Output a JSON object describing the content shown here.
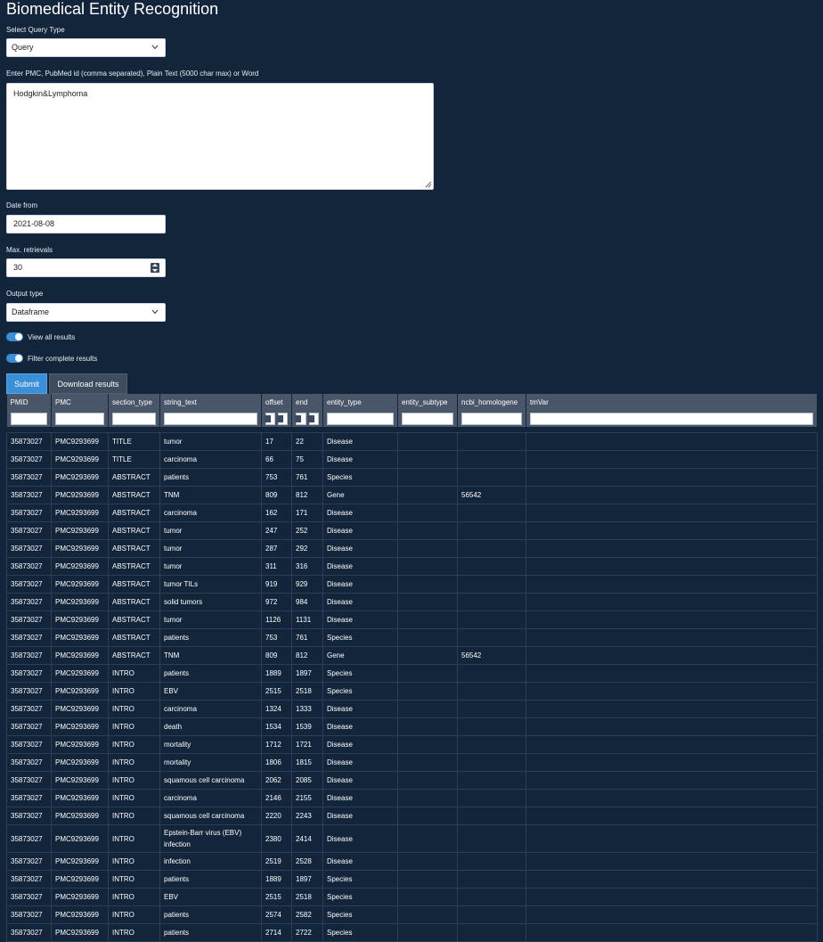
{
  "app": {
    "title": "Biomedical Entity Recognition"
  },
  "query_type": {
    "label": "Select Query Type",
    "value": "Query"
  },
  "query_input": {
    "label": "Enter PMC, PubMed id (comma separated), Plain Text (5000 char max) or Word",
    "value": "Hodgkin&Lymphoma"
  },
  "date_from": {
    "label": "Date from",
    "value": "2021-08-08"
  },
  "max_retrievals": {
    "label": "Max. retrievals",
    "value": "30"
  },
  "output_type": {
    "label": "Output type",
    "value": "Dataframe"
  },
  "toggles": {
    "view_all": {
      "label": "View all results",
      "on": true
    },
    "filter_complete": {
      "label": "Filter complete results",
      "on": true
    }
  },
  "buttons": {
    "submit": "Submit",
    "download": "Download results"
  },
  "colors": {
    "background": "#13253a",
    "accent": "#3b8ed8",
    "header": "#495669"
  },
  "table": {
    "columns": [
      "PMID",
      "PMC",
      "section_type",
      "string_text",
      "offset",
      "end",
      "entity_type",
      "entity_subtype",
      "ncbi_homologene",
      "tmVar"
    ],
    "rows": [
      [
        "35873027",
        "PMC9293699",
        "TITLE",
        "tumor",
        "17",
        "22",
        "Disease",
        "",
        "",
        ""
      ],
      [
        "35873027",
        "PMC9293699",
        "TITLE",
        "carcinoma",
        "66",
        "75",
        "Disease",
        "",
        "",
        ""
      ],
      [
        "35873027",
        "PMC9293699",
        "ABSTRACT",
        "patients",
        "753",
        "761",
        "Species",
        "",
        "",
        ""
      ],
      [
        "35873027",
        "PMC9293699",
        "ABSTRACT",
        "TNM",
        "809",
        "812",
        "Gene",
        "",
        "56542",
        ""
      ],
      [
        "35873027",
        "PMC9293699",
        "ABSTRACT",
        "carcinoma",
        "162",
        "171",
        "Disease",
        "",
        "",
        ""
      ],
      [
        "35873027",
        "PMC9293699",
        "ABSTRACT",
        "tumor",
        "247",
        "252",
        "Disease",
        "",
        "",
        ""
      ],
      [
        "35873027",
        "PMC9293699",
        "ABSTRACT",
        "tumor",
        "287",
        "292",
        "Disease",
        "",
        "",
        ""
      ],
      [
        "35873027",
        "PMC9293699",
        "ABSTRACT",
        "tumor",
        "311",
        "316",
        "Disease",
        "",
        "",
        ""
      ],
      [
        "35873027",
        "PMC9293699",
        "ABSTRACT",
        "tumor TILs",
        "919",
        "929",
        "Disease",
        "",
        "",
        ""
      ],
      [
        "35873027",
        "PMC9293699",
        "ABSTRACT",
        "solid tumors",
        "972",
        "984",
        "Disease",
        "",
        "",
        ""
      ],
      [
        "35873027",
        "PMC9293699",
        "ABSTRACT",
        "tumor",
        "1126",
        "1131",
        "Disease",
        "",
        "",
        ""
      ],
      [
        "35873027",
        "PMC9293699",
        "ABSTRACT",
        "patients",
        "753",
        "761",
        "Species",
        "",
        "",
        ""
      ],
      [
        "35873027",
        "PMC9293699",
        "ABSTRACT",
        "TNM",
        "809",
        "812",
        "Gene",
        "",
        "56542",
        ""
      ],
      [
        "35873027",
        "PMC9293699",
        "INTRO",
        "patients",
        "1889",
        "1897",
        "Species",
        "",
        "",
        ""
      ],
      [
        "35873027",
        "PMC9293699",
        "INTRO",
        "EBV",
        "2515",
        "2518",
        "Species",
        "",
        "",
        ""
      ],
      [
        "35873027",
        "PMC9293699",
        "INTRO",
        "carcinoma",
        "1324",
        "1333",
        "Disease",
        "",
        "",
        ""
      ],
      [
        "35873027",
        "PMC9293699",
        "INTRO",
        "death",
        "1534",
        "1539",
        "Disease",
        "",
        "",
        ""
      ],
      [
        "35873027",
        "PMC9293699",
        "INTRO",
        "mortality",
        "1712",
        "1721",
        "Disease",
        "",
        "",
        ""
      ],
      [
        "35873027",
        "PMC9293699",
        "INTRO",
        "mortality",
        "1806",
        "1815",
        "Disease",
        "",
        "",
        ""
      ],
      [
        "35873027",
        "PMC9293699",
        "INTRO",
        "squamous cell carcinoma",
        "2062",
        "2085",
        "Disease",
        "",
        "",
        ""
      ],
      [
        "35873027",
        "PMC9293699",
        "INTRO",
        "carcinoma",
        "2146",
        "2155",
        "Disease",
        "",
        "",
        ""
      ],
      [
        "35873027",
        "PMC9293699",
        "INTRO",
        "squamous cell carcinoma",
        "2220",
        "2243",
        "Disease",
        "",
        "",
        ""
      ],
      [
        "35873027",
        "PMC9293699",
        "INTRO",
        "Epstein-Barr virus (EBV) infection",
        "2380",
        "2414",
        "Disease",
        "",
        "",
        ""
      ],
      [
        "35873027",
        "PMC9293699",
        "INTRO",
        "infection",
        "2519",
        "2528",
        "Disease",
        "",
        "",
        ""
      ],
      [
        "35873027",
        "PMC9293699",
        "INTRO",
        "patients",
        "1889",
        "1897",
        "Species",
        "",
        "",
        ""
      ],
      [
        "35873027",
        "PMC9293699",
        "INTRO",
        "EBV",
        "2515",
        "2518",
        "Species",
        "",
        "",
        ""
      ],
      [
        "35873027",
        "PMC9293699",
        "INTRO",
        "patients",
        "2574",
        "2582",
        "Species",
        "",
        "",
        ""
      ],
      [
        "35873027",
        "PMC9293699",
        "INTRO",
        "patients",
        "2714",
        "2722",
        "Species",
        "",
        "",
        ""
      ]
    ]
  }
}
